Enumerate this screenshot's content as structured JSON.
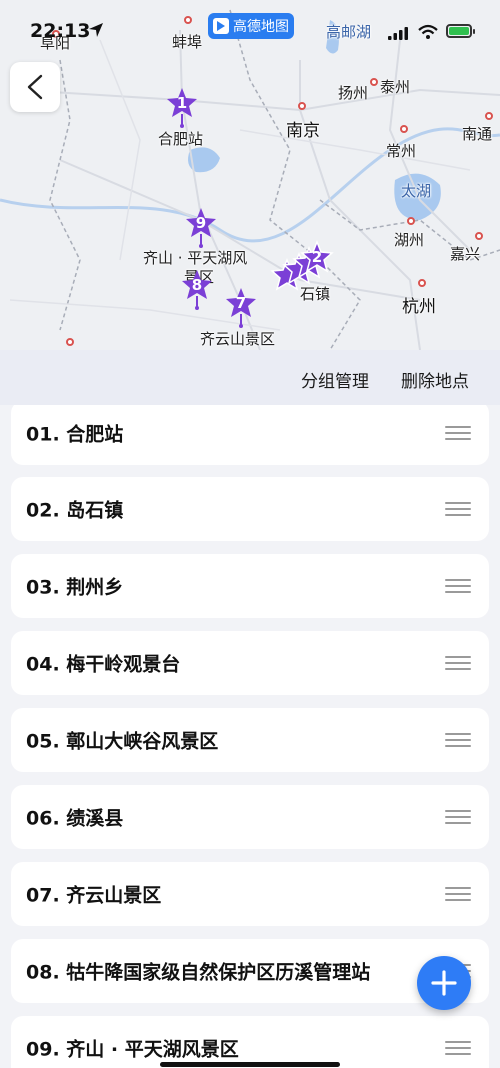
{
  "status": {
    "time": "22:13"
  },
  "app_pill": {
    "label": "高德地图"
  },
  "map": {
    "labels": {
      "fuyang": "阜阳",
      "bengbu": "蚌埠",
      "gaoyouhu": "高邮湖",
      "yangzhou": "扬州",
      "taizhou": "泰州",
      "hefei_station": "合肥站",
      "nanjing": "南京",
      "changzhou": "常州",
      "nantong": "南通",
      "taihu": "太湖",
      "huzhou": "湖州",
      "jiaxing": "嘉兴",
      "hangzhou": "杭州",
      "qishan_line1": "齐山 · 平天湖风",
      "qishan_line2": "景区",
      "daoshizhen_tail": "石镇",
      "qiyunshan": "齐云山景区"
    },
    "markers": [
      "1",
      "9",
      "8",
      "7",
      "2"
    ]
  },
  "toolbar": {
    "group_manage": "分组管理",
    "delete_place": "删除地点"
  },
  "places": [
    "01. 合肥站",
    "02. 岛石镇",
    "03. 荆州乡",
    "04. 梅干岭观景台",
    "05. 鄣山大峡谷风景区",
    "06. 绩溪县",
    "07. 齐云山景区",
    "08. 牯牛降国家级自然保护区历溪管理站",
    "09. 齐山 · 平天湖风景区"
  ],
  "colors": {
    "accent": "#2e7cf6",
    "marker": "#7b3fd6",
    "toolbar_bg": "#eaecf4"
  }
}
